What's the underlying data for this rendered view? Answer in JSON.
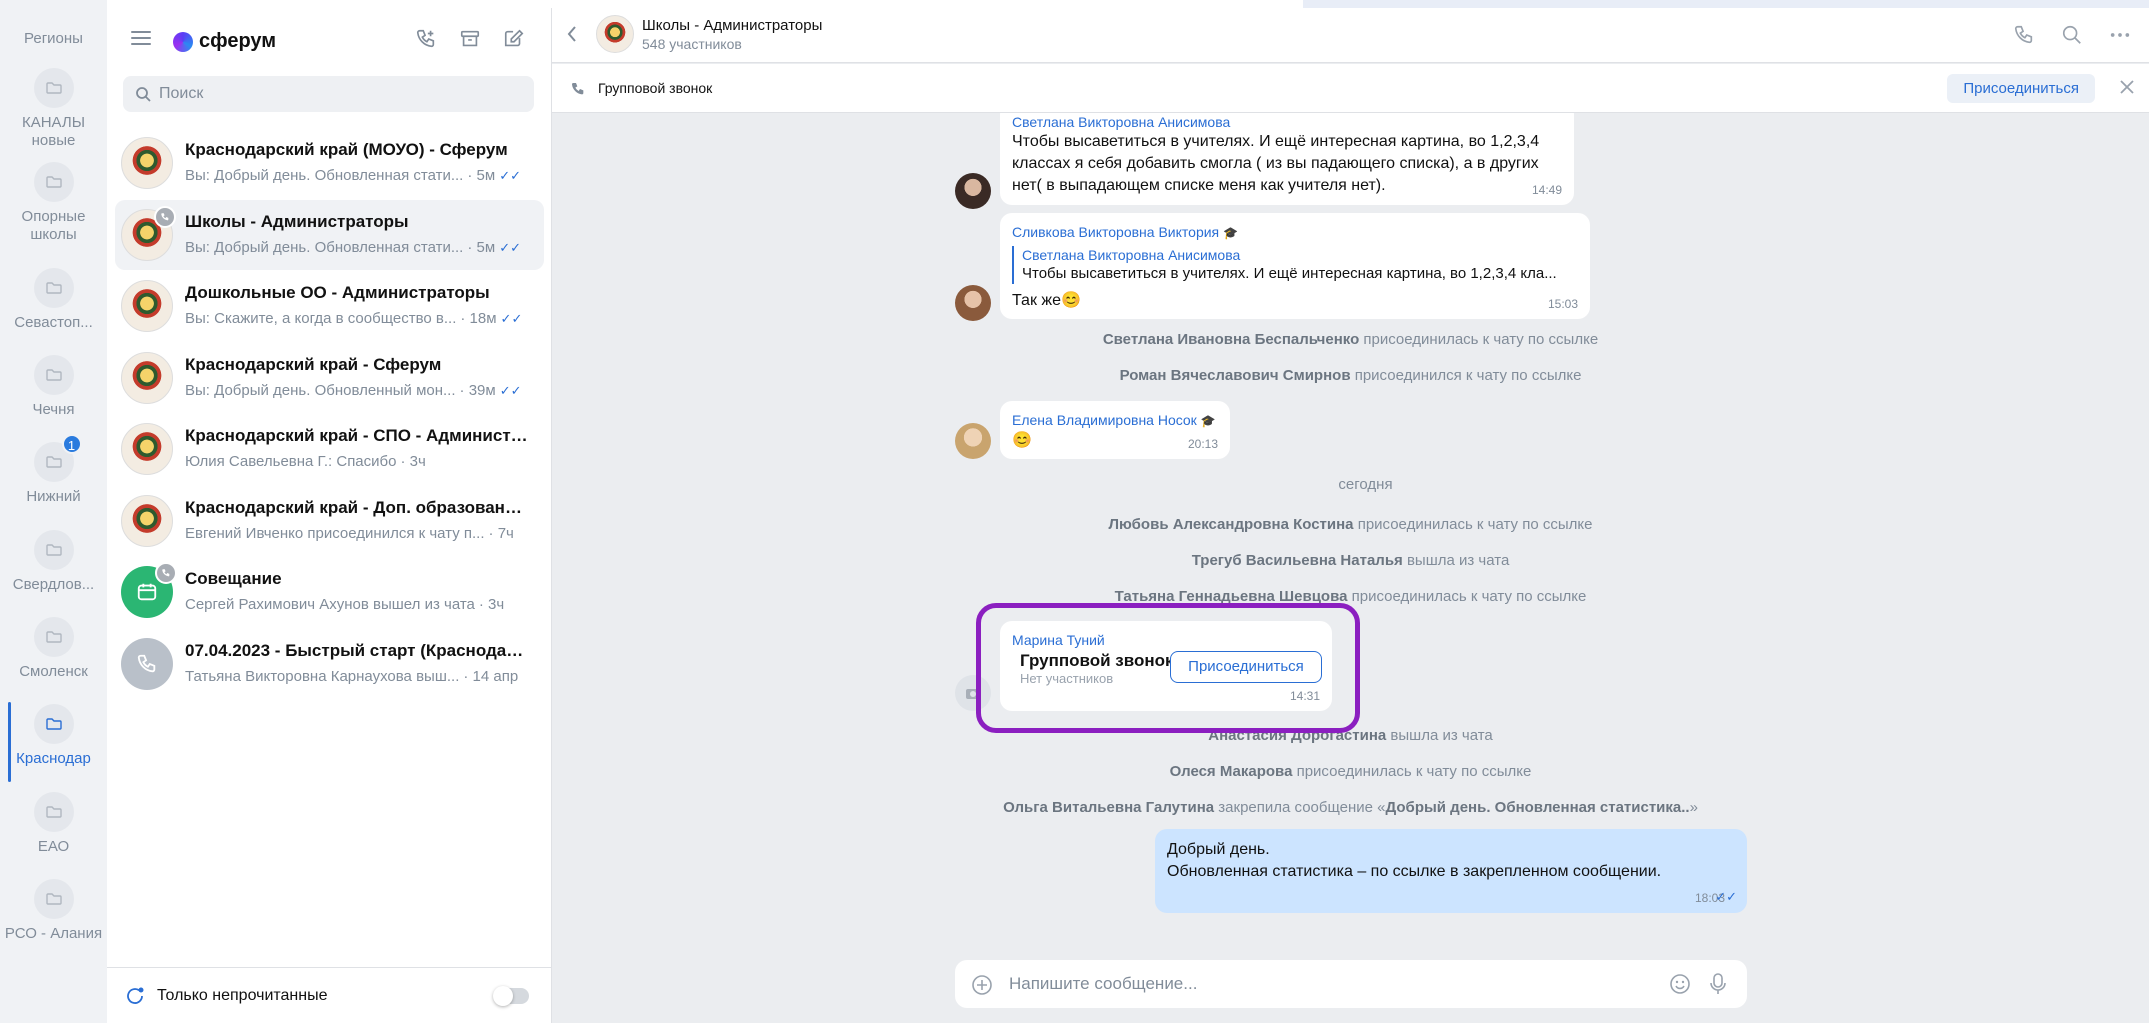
{
  "folders": {
    "title": "Регионы",
    "items": [
      {
        "label": "КАНАЛЫ новые"
      },
      {
        "label": "Опорные школы"
      },
      {
        "label": "Севастоп..."
      },
      {
        "label": "Чечня"
      },
      {
        "label": "Нижний",
        "badge": "1"
      },
      {
        "label": "Свердлов..."
      },
      {
        "label": "Смоленск"
      },
      {
        "label": "Краснодар",
        "active": true
      },
      {
        "label": "ЕАО"
      },
      {
        "label": "РСО - Алания"
      }
    ]
  },
  "app": {
    "logo": "сферум"
  },
  "search": {
    "placeholder": "Поиск"
  },
  "chats": [
    {
      "name": "Краснодарский край (МОУО) - Сферум",
      "preview": "Вы: Добрый день. Обновленная стати...",
      "time": " · 5м",
      "read": true
    },
    {
      "name": "Школы - Администраторы",
      "preview": "Вы: Добрый день. Обновленная стати...",
      "time": " · 5м",
      "read": true,
      "selected": true,
      "call": true
    },
    {
      "name": "Дошкольные ОО - Администраторы",
      "preview": "Вы: Скажите, а когда в сообщество в...",
      "time": " · 18м",
      "read": true
    },
    {
      "name": "Краснодарский край - Сферум",
      "preview": "Вы: Добрый день. Обновленный мон...",
      "time": " · 39м",
      "read": true
    },
    {
      "name": "Краснодарский край - СПО - Администра...",
      "preview": "Юлия Савельевна Г.: Спасибо",
      "time": " · 3ч",
      "read": false
    },
    {
      "name": "Краснодарский край - Доп. образование. ...",
      "preview": "Евгений Ивченко присоединился к чату п...",
      "time": " · 7ч",
      "read": false
    },
    {
      "name": "Совещание",
      "preview": "Сергей Рахимович Ахунов вышел из чата",
      "time": " · 3ч",
      "read": false,
      "call": true
    },
    {
      "name": "07.04.2023 - Быстрый старт (Краснодарс...",
      "preview": "Татьяна Викторовна Карнаухова выш...",
      "time": " · 14 апр",
      "read": false
    }
  ],
  "unread_toggle": {
    "label": "Только непрочитанные"
  },
  "header": {
    "title": "Школы - Администраторы",
    "subtitle": "548 участников"
  },
  "callbar": {
    "title": "Групповой звонок",
    "join": "Присоединиться"
  },
  "messages": {
    "m1": {
      "sender": "Светлана Викторовна Анисимова",
      "text": "Чтобы высаветиться в учителях. И ещё интересная картина, во 1,2,3,4 классах я себя добавить смогла ( из вы падающего списка), а в других нет( в выпадающем списке меня как учителя нет).",
      "time": "14:49"
    },
    "m2": {
      "sender": "Сливкова Викторовна Виктория",
      "quote_sender": "Светлана Викторовна Анисимова",
      "quote_text": "Чтобы высаветиться в учителях. И ещё интересная картина, во 1,2,3,4 кла...",
      "text": "Так же😊",
      "time": "15:03"
    },
    "s1": {
      "name": "Светлана Ивановна Беспальченко",
      "action": " присоединилась к чату по ссылке"
    },
    "s2": {
      "name": "Роман Вячеславович Смирнов",
      "action": " присоединился к чату по ссылке"
    },
    "m3": {
      "sender": "Елена Владимировна Носок",
      "text": "😊",
      "time": "20:13"
    },
    "date": "сегодня",
    "s3": {
      "name": "Любовь Александровна Костина",
      "action": " присоединилась к чату по ссылке"
    },
    "s4": {
      "name": "Трегуб Васильевна Наталья",
      "action": " вышла из чата"
    },
    "s5": {
      "name": "Татьяна Геннадьевна Шевцова",
      "action": " присоединилась к чату по ссылке"
    },
    "call": {
      "sender": "Марина Туний",
      "title": "Групповой звонок",
      "sub": "Нет участников",
      "join": "Присоединиться",
      "time": "14:31"
    },
    "s6": {
      "name": "Анастасия Дорогастина",
      "action": " вышла из чата"
    },
    "s7": {
      "name": "Олеся Макарова",
      "action": " присоединилась к чату по ссылке"
    },
    "s8": {
      "name": "Ольга Витальевна Галутина",
      "action": " закрепила сообщение «",
      "pinned": "Добрый день. Обновленная статистика..",
      "end": "»"
    },
    "out": {
      "line1": "Добрый день.",
      "line2": "Обновленная статистика – по ссылке в закрепленном сообщении.",
      "time": "18:03"
    }
  },
  "composer": {
    "placeholder": "Напишите сообщение..."
  },
  "colors": {
    "accent": "#2a6ed4",
    "highlight": "#8b1fc0",
    "outgoing": "#cce4ff"
  }
}
